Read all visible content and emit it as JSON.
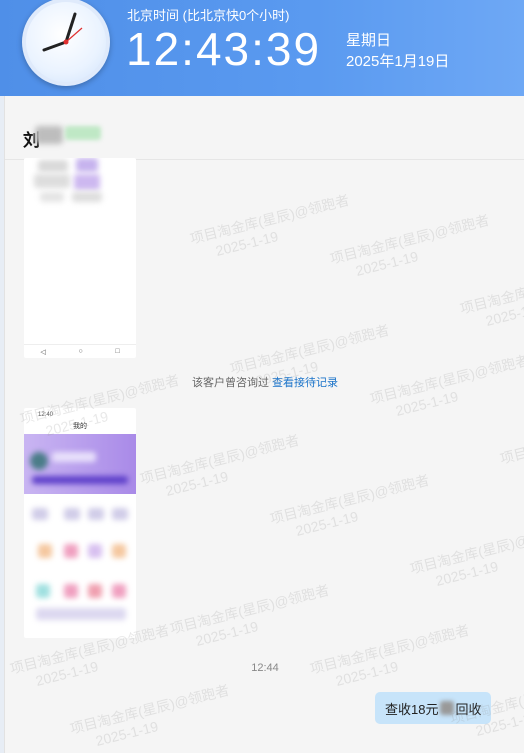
{
  "clock": {
    "timezone_label": "北京时间 (比北京快0个小时)",
    "time": "12:43:39",
    "weekday": "星期日",
    "date": "2025年1月19日"
  },
  "chat": {
    "contact_name_visible": "刘",
    "system_notice": "该客户曾咨询过",
    "system_notice_link": "查看接待记录",
    "timestamp": "12:44",
    "message_before_mask": "查收18元",
    "message_after_mask": "回收"
  },
  "phone_shot_2": {
    "status_time": "12:40",
    "page_title": "我的"
  },
  "watermark": {
    "line1": "项目淘金库(星辰)@领跑者",
    "line2": "2025-1-19"
  },
  "colors": {
    "header_blue": "#5a9af0",
    "bubble": "#c7e4fa",
    "link": "#1a73c9"
  }
}
